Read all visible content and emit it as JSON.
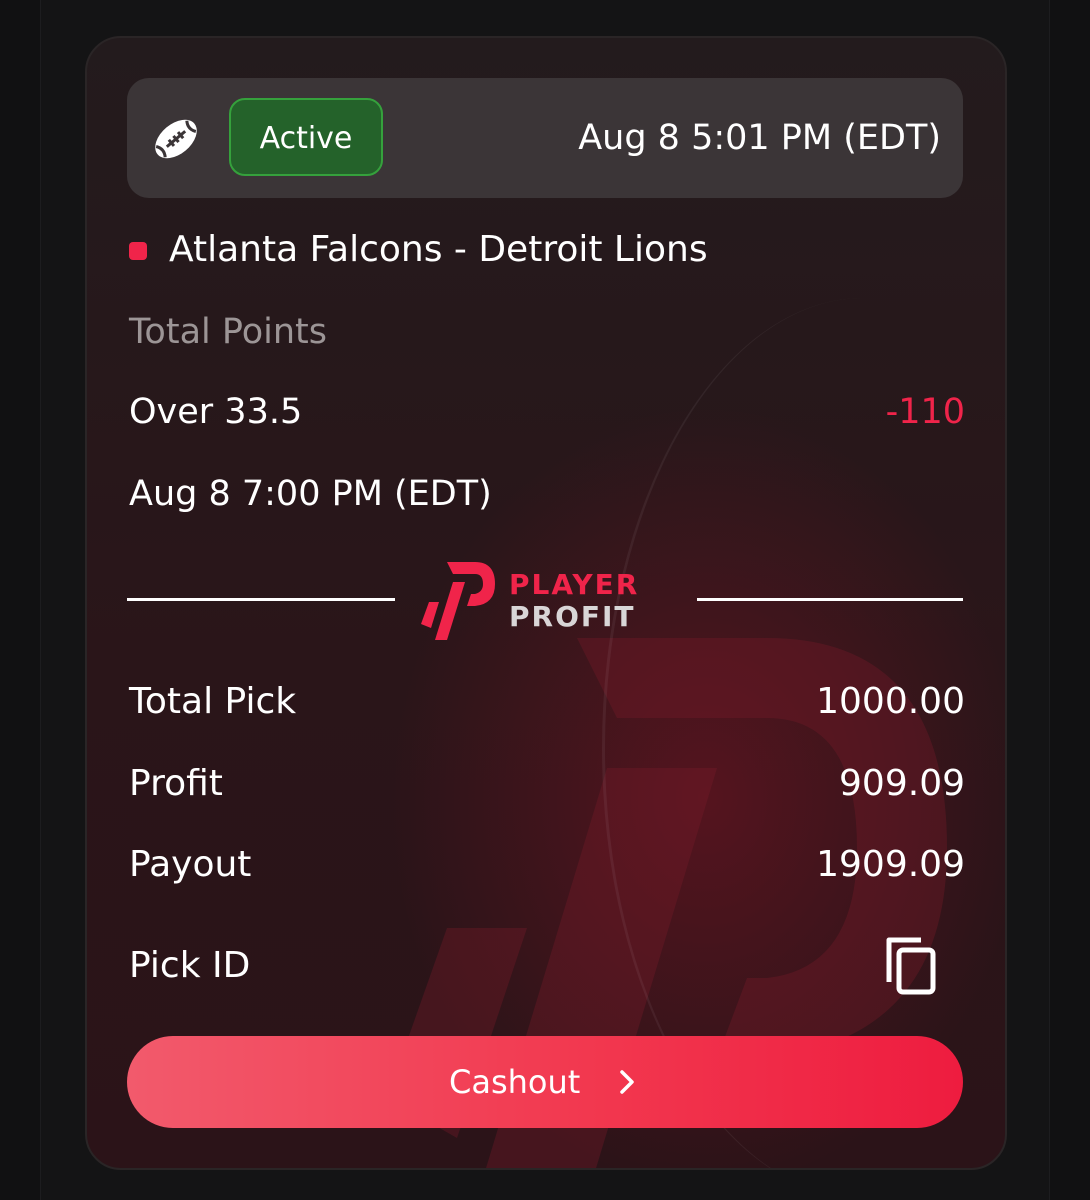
{
  "bet": {
    "sport_icon": "football-icon",
    "status": "Active",
    "placed_time": "Aug 8 5:01 PM (EDT)",
    "match": "Atlanta Falcons - Detroit Lions",
    "market": "Total Points",
    "selection": "Over 33.5",
    "odds": "-110",
    "event_time": "Aug 8 7:00 PM (EDT)"
  },
  "brand": {
    "word1": "PLAYER",
    "word2": "PROFIT"
  },
  "summary": {
    "total_pick_label": "Total Pick",
    "total_pick_value": "1000.00",
    "profit_label": "Profit",
    "profit_value": "909.09",
    "payout_label": "Payout",
    "payout_value": "1909.09",
    "pick_id_label": "Pick ID",
    "copy_icon": "copy-icon"
  },
  "actions": {
    "cashout_label": "Cashout",
    "cashout_icon": "chevron-right-icon"
  },
  "colors": {
    "accent": "#f0244a",
    "active_green": "#24622a",
    "card_bg": "#2a1519"
  }
}
